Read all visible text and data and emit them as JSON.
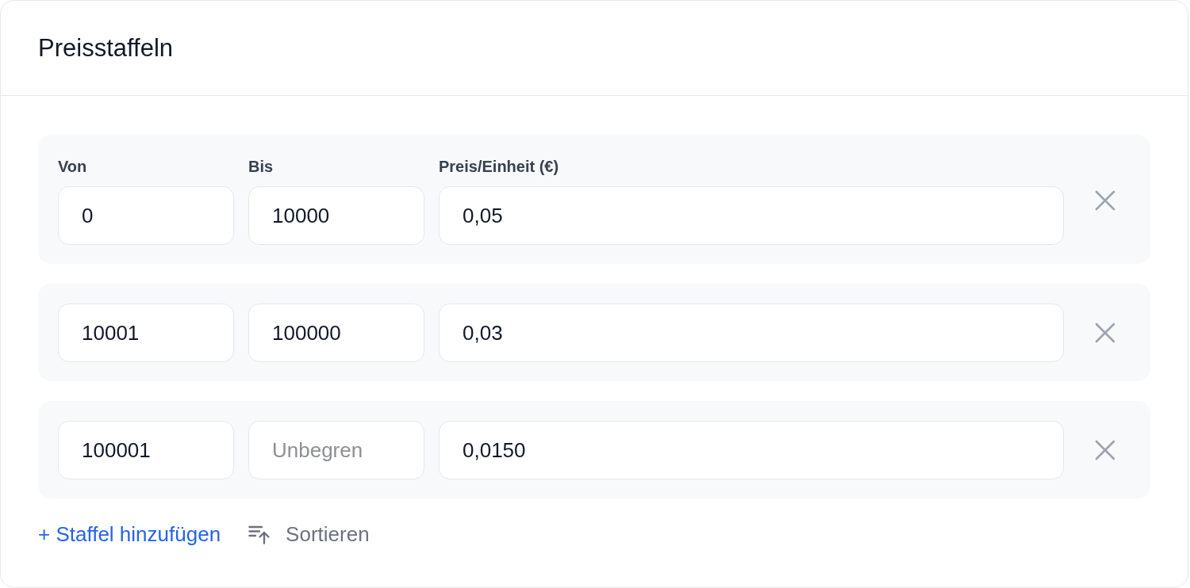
{
  "card": {
    "title": "Preisstaffeln"
  },
  "columns": [
    "Von",
    "Bis",
    "Preis/Einheit (€)"
  ],
  "tiers": [
    {
      "from": {
        "value": "0"
      },
      "to": {
        "value": "10000"
      },
      "price": {
        "value": "0,05"
      }
    },
    {
      "from": {
        "value": "10001"
      },
      "to": {
        "value": "100000"
      },
      "price": {
        "value": "0,03"
      }
    },
    {
      "from": {
        "value": "100001"
      },
      "to": {
        "placeholder": "Unbegren"
      },
      "price": {
        "value": "0,0150"
      }
    }
  ],
  "actions": [
    {
      "kind": "add",
      "label": "+ Staffel hinzufügen"
    },
    {
      "kind": "sort",
      "label": "Sortieren"
    }
  ]
}
